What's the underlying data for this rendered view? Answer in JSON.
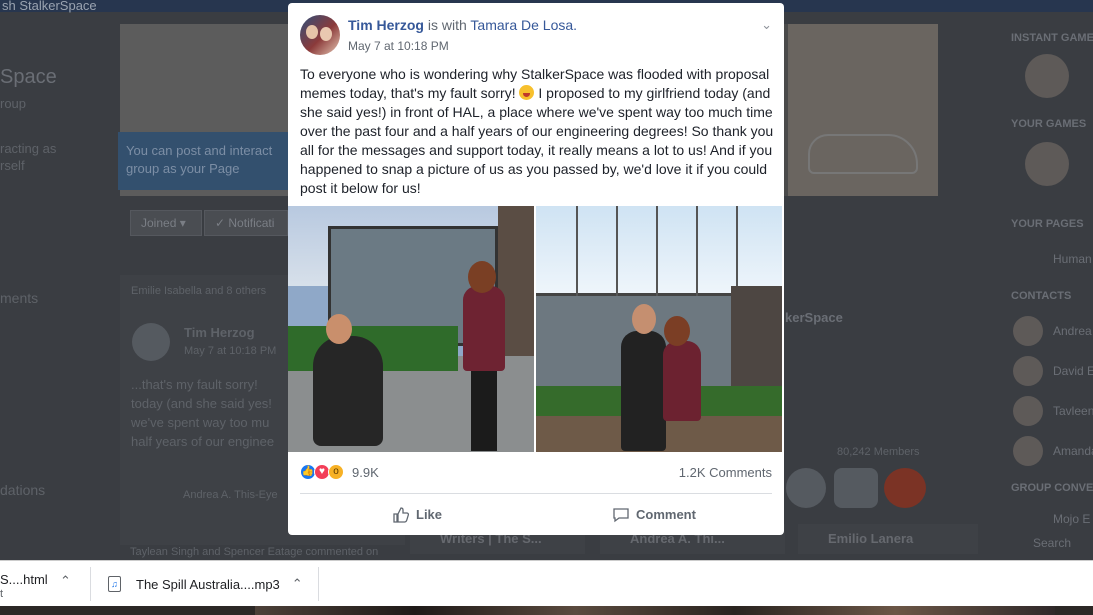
{
  "browser": {
    "tab_text": "sh StalkerSpace"
  },
  "background": {
    "group_title_partial": "Space",
    "group_subtitle_partial": "roup",
    "interacting_text": "racting as\nrself",
    "tip_text": "You can post and interact\ngroup as your Page",
    "joined_label": "Joined ▾",
    "notifications_label": "✓ Notificati",
    "reactions_line": "Emilie Isabella and 8 others",
    "post_author": "Tim Herzog",
    "post_date": "May 7 at 10:18 PM",
    "post_snippet": "...that's my fault sorry! \ntoday (and she said yes!\nwe've spent way too mu\nhalf years of our enginee",
    "post_reactors": "Andrea A. This-Eye",
    "menu_ments": "ments",
    "menu_dations": "dations",
    "commented_line": "Taylean Singh and Spencer Eatage commented on",
    "group_name_partial": "kerSpace",
    "members_count": "80,242 Members",
    "chat_tabs": [
      "Writers | The S...",
      "Andrea A. Thi...",
      "Emilio Lanera"
    ]
  },
  "right_column": {
    "instant_games": "INSTANT GAMES",
    "your_games": "YOUR GAMES",
    "your_pages": "YOUR PAGES",
    "page_name": "Human",
    "contacts": "CONTACTS",
    "contact_names": [
      "Andrea",
      "David E",
      "Tavleen",
      "Amanda"
    ],
    "group_conv": "GROUP CONVE",
    "group_item": "Mojo E",
    "search": "Search"
  },
  "post": {
    "author": "Tim Herzog",
    "with_text": "is with",
    "friend": "Tamara De Losa.",
    "timestamp": "May 7 at 10:18 PM",
    "text_part1": "To everyone who is wondering why StalkerSpace was flooded with proposal memes today, that's my fault sorry!",
    "text_part2": " I proposed to my girlfriend today (and she said yes!) in front of HAL, a place where we've spent way too much time over the past four and a half years of our engineering degrees! So thank you all for the messages and support today, it really means a lot to us! And if you happened to snap a picture of us as you passed by, we'd love it if you could post it below for us!",
    "reaction_count": "9.9K",
    "comment_count": "1.2K Comments",
    "like_label": "Like",
    "comment_label": "Comment"
  },
  "downloads": [
    {
      "name": "S....html",
      "sub": "t"
    },
    {
      "name": "The Spill Australia....mp3"
    }
  ],
  "colors": {
    "link": "#365899",
    "like_blue": "#1877f2",
    "love_red": "#f33e58",
    "wow_yellow": "#f7b125"
  }
}
